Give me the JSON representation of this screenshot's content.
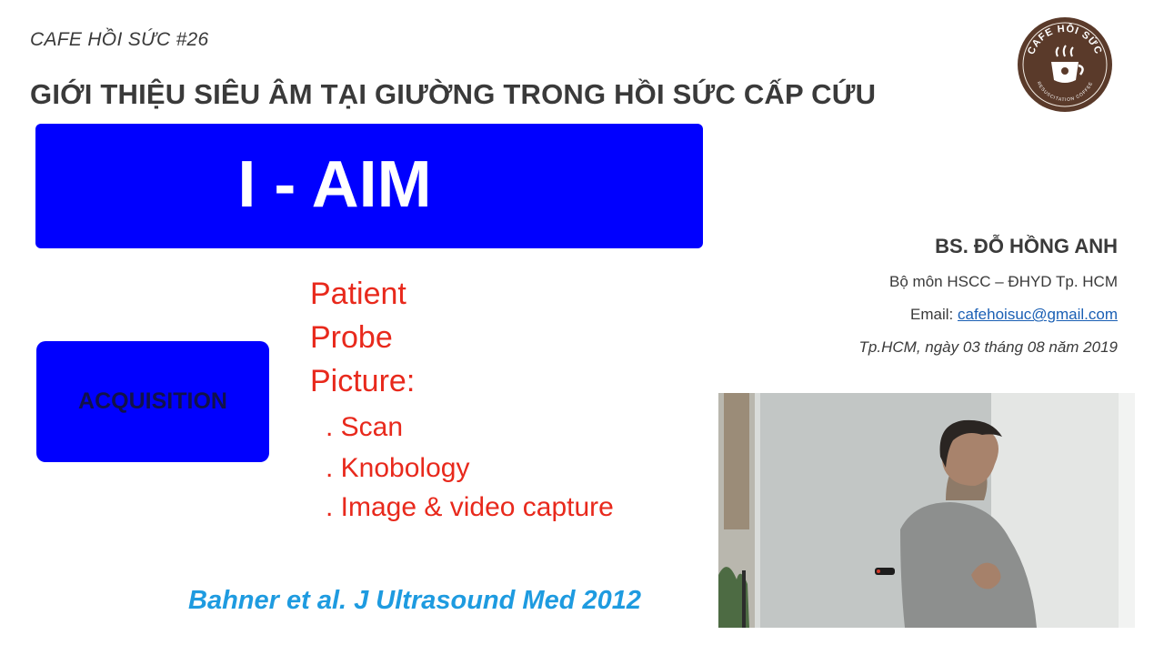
{
  "header": {
    "series": "CAFE HỒI SỨC #26",
    "title": "GIỚI THIỆU SIÊU ÂM TẠI GIƯỜNG TRONG HỒI SỨC CẤP CỨU"
  },
  "logo": {
    "ring_text_top": "CAFE HỒI SỨC",
    "ring_text_bottom": "RESUSCITATION COFFEE",
    "icon": "coffee-cup-stethoscope-icon",
    "color": "#5a3a2a"
  },
  "aim_box": {
    "title": "I - AIM",
    "color": "#0000ff"
  },
  "acquisition_box": {
    "label": "ACQUISITION",
    "color": "#0000ff"
  },
  "items": {
    "patient": "Patient",
    "probe": "Probe",
    "picture": "Picture:",
    "scan": ". Scan",
    "knobology": ". Knobology",
    "capture": ". Image & video capture",
    "color": "#e8291c"
  },
  "presenter": {
    "name": "BS. ĐỖ HỒNG ANH",
    "department": "Bộ môn HSCC – ĐHYD Tp.  HCM",
    "email_label": "Email: ",
    "email": "cafehoisuc@gmail.com",
    "date": "Tp.HCM, ngày 03 tháng 08 năm 2019"
  },
  "citation": "Bahner et al. J Ultrasound Med 2012"
}
